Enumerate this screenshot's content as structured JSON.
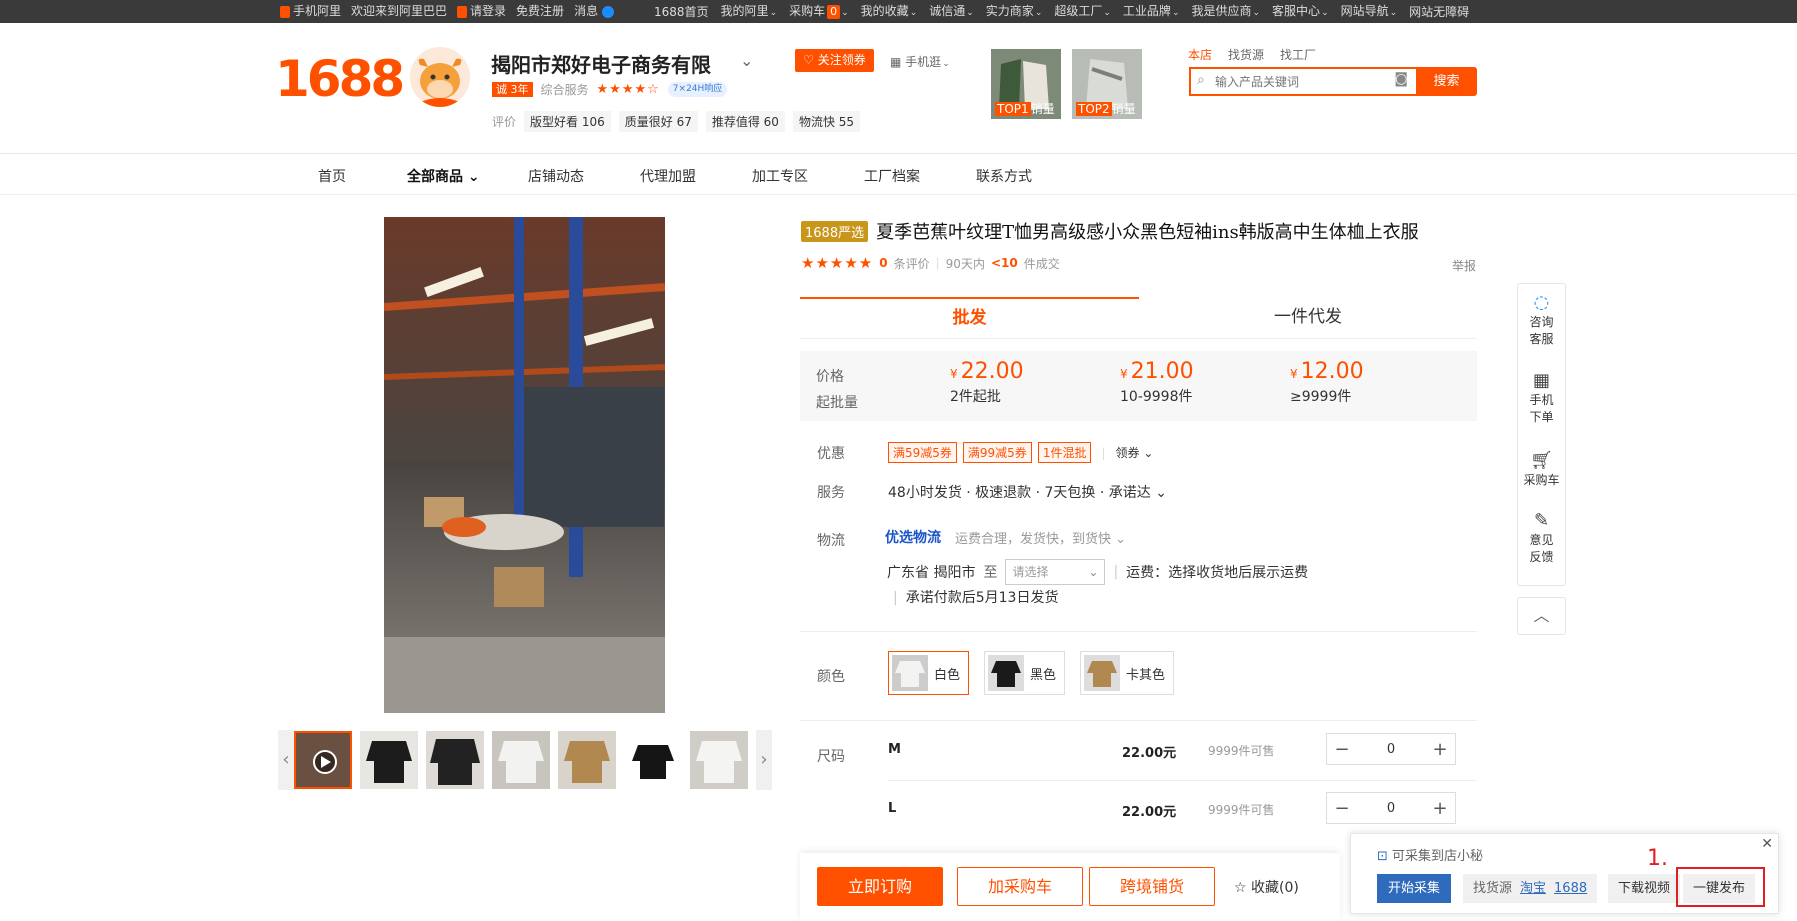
{
  "topbar": {
    "left": [
      "手机阿里",
      "欢迎来到阿里巴巴",
      "请登录",
      "免费注册",
      "消息"
    ],
    "links": [
      "1688首页",
      "我的阿里",
      "采购车",
      "我的收藏",
      "诚信通",
      "实力商家",
      "超级工厂",
      "工业品牌",
      "我是供应商",
      "客服中心",
      "网站导航",
      "网站无障碍"
    ],
    "cart_count": "0"
  },
  "header": {
    "logo": "1688",
    "shop_name": "揭阳市郑好电子商务有限",
    "years_badge": "诚 3年",
    "service_label": "综合服务",
    "stars": "★★★★☆",
    "badge_24": "7×24H响应",
    "follow": "关注领券",
    "mobile": "手机逛",
    "rating_label": "评价",
    "ratings": [
      "版型好看 106",
      "质量很好 67",
      "推荐值得 60",
      "物流快 55"
    ],
    "top_items": [
      {
        "rank": "TOP1",
        "label": "销量"
      },
      {
        "rank": "TOP2",
        "label": "销量"
      }
    ],
    "search_tabs": [
      "本店",
      "找货源",
      "找工厂"
    ],
    "search_placeholder": "输入产品关键词",
    "search_btn": "搜索"
  },
  "nav": [
    "首页",
    "全部商品",
    "店铺动态",
    "代理加盟",
    "加工专区",
    "工厂档案",
    "联系方式"
  ],
  "product": {
    "badge": "1688严选",
    "title": "夏季芭蕉叶纹理T恤男高级感小众黑色短袖ins韩版高中生体桖上衣服",
    "review_stars": "★★★★★",
    "review_count": "0",
    "review_unit": "条评价",
    "days": "90天内",
    "sold": "<10",
    "sold_unit": "件成交",
    "report": "举报",
    "tabs": [
      "批发",
      "一件代发"
    ],
    "price_label": "价格",
    "qty_label": "起批量",
    "currency": "¥",
    "prices": [
      {
        "price": "22.00",
        "qty": "2件起批"
      },
      {
        "price": "21.00",
        "qty": "10-9998件"
      },
      {
        "price": "12.00",
        "qty": "≥9999件"
      }
    ],
    "promo_label": "优惠",
    "promos": [
      "满59减5券",
      "满99减5券",
      "1件混批"
    ],
    "coupon": "领券",
    "service_label": "服务",
    "service": "48小时发货 · 极速退款 · 7天包换 · 承诺达",
    "logistics_label": "物流",
    "logi_brand": "优选物流",
    "logi_desc": "运费合理，发货快，到货快",
    "origin": "广东省 揭阳市",
    "to": "至",
    "select_placeholder": "请选择",
    "freight": "运费：选择收货地后展示运费",
    "ship_promise": "承诺付款后5月13日发货",
    "color_label": "颜色",
    "colors": [
      "白色",
      "黑色",
      "卡其色"
    ],
    "size_label": "尺码",
    "sizes": [
      {
        "name": "M",
        "price": "22.00元",
        "stock": "9999件可售",
        "qty": "0"
      },
      {
        "name": "L",
        "price": "22.00元",
        "stock": "9999件可售",
        "qty": "0"
      }
    ]
  },
  "buybar": {
    "order": "立即订购",
    "cart": "加采购车",
    "cross": "跨境铺货",
    "fav": "收藏(0)"
  },
  "side_tools": [
    "咨询客服",
    "手机下单",
    "采购车",
    "意见反馈"
  ],
  "popup": {
    "header": "可采集到店小秘",
    "start": "开始采集",
    "find_src": "找货源",
    "src_links": [
      "淘宝",
      "1688"
    ],
    "download": "下载视频",
    "publish": "一键发布",
    "annotation": "1."
  }
}
